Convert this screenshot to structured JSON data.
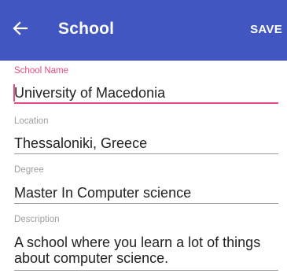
{
  "appbar": {
    "title": "School",
    "save_label": "SAVE",
    "back_icon": "arrow-left-icon",
    "background_color": "#4156c1"
  },
  "form": {
    "accent_color": "#e84a86",
    "fields": [
      {
        "label": "School Name",
        "value": "University of Macedonia",
        "focused": true
      },
      {
        "label": "Location",
        "value": "Thessaloniki, Greece",
        "focused": false
      },
      {
        "label": "Degree",
        "value": "Master In Computer science",
        "focused": false
      },
      {
        "label": "Description",
        "value": "A school where you learn a lot of things about computer science.",
        "focused": false
      }
    ]
  }
}
